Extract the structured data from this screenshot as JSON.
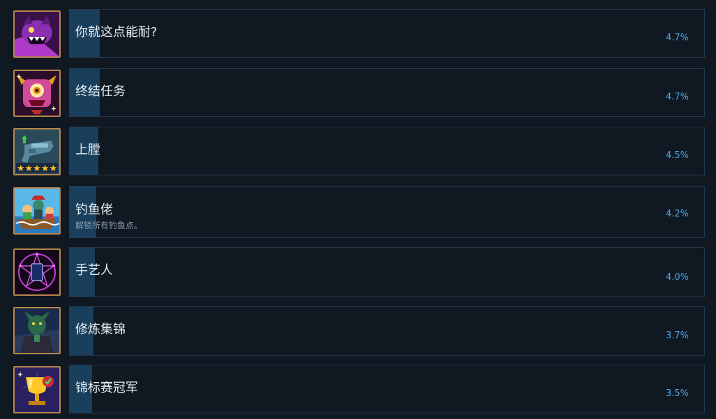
{
  "achievements": [
    {
      "title": "你就这点能耐?",
      "description": "",
      "percent_label": "4.7%",
      "percent": 4.7,
      "icon": "purple-monster-icon"
    },
    {
      "title": "终结任务",
      "description": "",
      "percent_label": "4.7%",
      "percent": 4.7,
      "icon": "horned-cyclops-icon"
    },
    {
      "title": "上膛",
      "description": "",
      "percent_label": "4.5%",
      "percent": 4.5,
      "icon": "upgraded-gun-icon"
    },
    {
      "title": "钓鱼佬",
      "description": "解锁所有钓鱼点。",
      "percent_label": "4.2%",
      "percent": 4.2,
      "icon": "fishing-boat-icon"
    },
    {
      "title": "手艺人",
      "description": "",
      "percent_label": "4.0%",
      "percent": 4.0,
      "icon": "pentagram-card-icon"
    },
    {
      "title": "修炼集锦",
      "description": "",
      "percent_label": "3.7%",
      "percent": 3.7,
      "icon": "dark-warrior-icon"
    },
    {
      "title": "锦标赛冠军",
      "description": "",
      "percent_label": "3.5%",
      "percent": 3.5,
      "icon": "trophy-icon"
    }
  ],
  "colors": {
    "background": "#101822",
    "bar_fill": "#1a3f5c",
    "percent_text": "#4fa8e6",
    "icon_border": "#b8864a"
  }
}
